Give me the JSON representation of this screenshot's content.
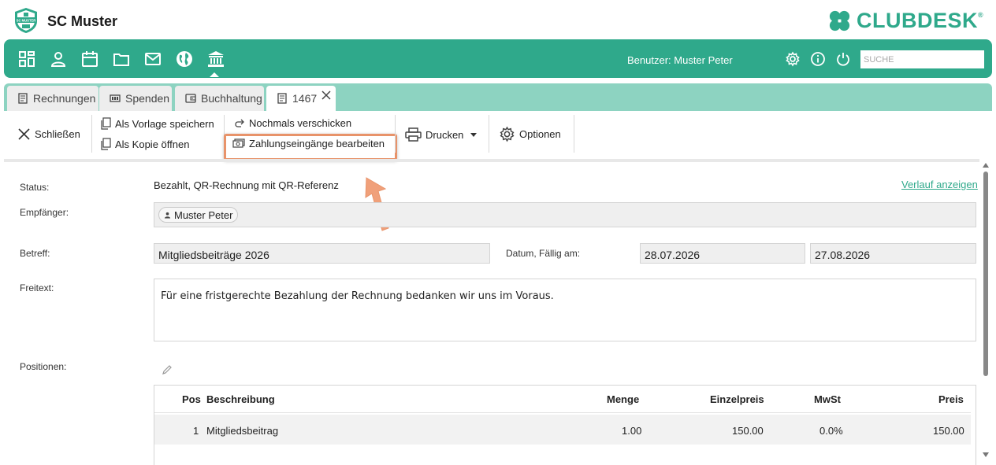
{
  "header": {
    "club_name": "SC Muster",
    "club_logo_text": "SC MUSTER",
    "brand": "CLUBDESK",
    "brand_reg": "®"
  },
  "topnav": {
    "icons": [
      "dashboard-icon",
      "person-icon",
      "calendar-icon",
      "folder-icon",
      "mail-icon",
      "globe-icon",
      "bank-icon"
    ],
    "active": "bank-icon",
    "user_label": "Benutzer: Muster Peter",
    "search_placeholder": "SUCHE",
    "right_icons": [
      "gear-icon",
      "info-icon",
      "power-icon"
    ]
  },
  "tabs": [
    {
      "label": "Rechnungen",
      "icon": "invoice-icon"
    },
    {
      "label": "Spenden",
      "icon": "donation-icon"
    },
    {
      "label": "Buchhaltung",
      "icon": "wallet-icon"
    },
    {
      "label": "1467",
      "icon": "invoice-icon",
      "active": true,
      "closable": true
    }
  ],
  "toolbar": {
    "close": "Schließen",
    "save_template": "Als Vorlage speichern",
    "open_copy": "Als Kopie öffnen",
    "resend": "Nochmals verschicken",
    "edit_payments": "Zahlungseingänge bearbeiten",
    "print": "Drucken",
    "options": "Optionen"
  },
  "form": {
    "status_label": "Status:",
    "status_value": "Bezahlt, QR-Rechnung mit QR-Referenz",
    "history_link": "Verlauf anzeigen",
    "recipient_label": "Empfänger:",
    "recipient_value": "Muster Peter",
    "subject_label": "Betreff:",
    "subject_value": "Mitgliedsbeiträge 2026",
    "date_label": "Datum, Fällig am:",
    "date_value": "28.07.2026",
    "due_value": "27.08.2026",
    "freetext_label": "Freitext:",
    "freetext_value": "Für eine fristgerechte Bezahlung der Rechnung bedanken wir uns im Voraus.",
    "positions_label": "Positionen:"
  },
  "positions": {
    "headers": {
      "pos": "Pos",
      "desc": "Beschreibung",
      "qty": "Menge",
      "unit": "Einzelpreis",
      "vat": "MwSt",
      "price": "Preis"
    },
    "rows": [
      {
        "pos": "1",
        "desc": "Mitgliedsbeitrag",
        "qty": "1.00",
        "unit": "150.00",
        "vat": "0.0%",
        "price": "150.00"
      }
    ]
  },
  "colors": {
    "brand": "#2fa98b",
    "tabbar": "#8dd3c1",
    "highlight": "#e8936a"
  }
}
